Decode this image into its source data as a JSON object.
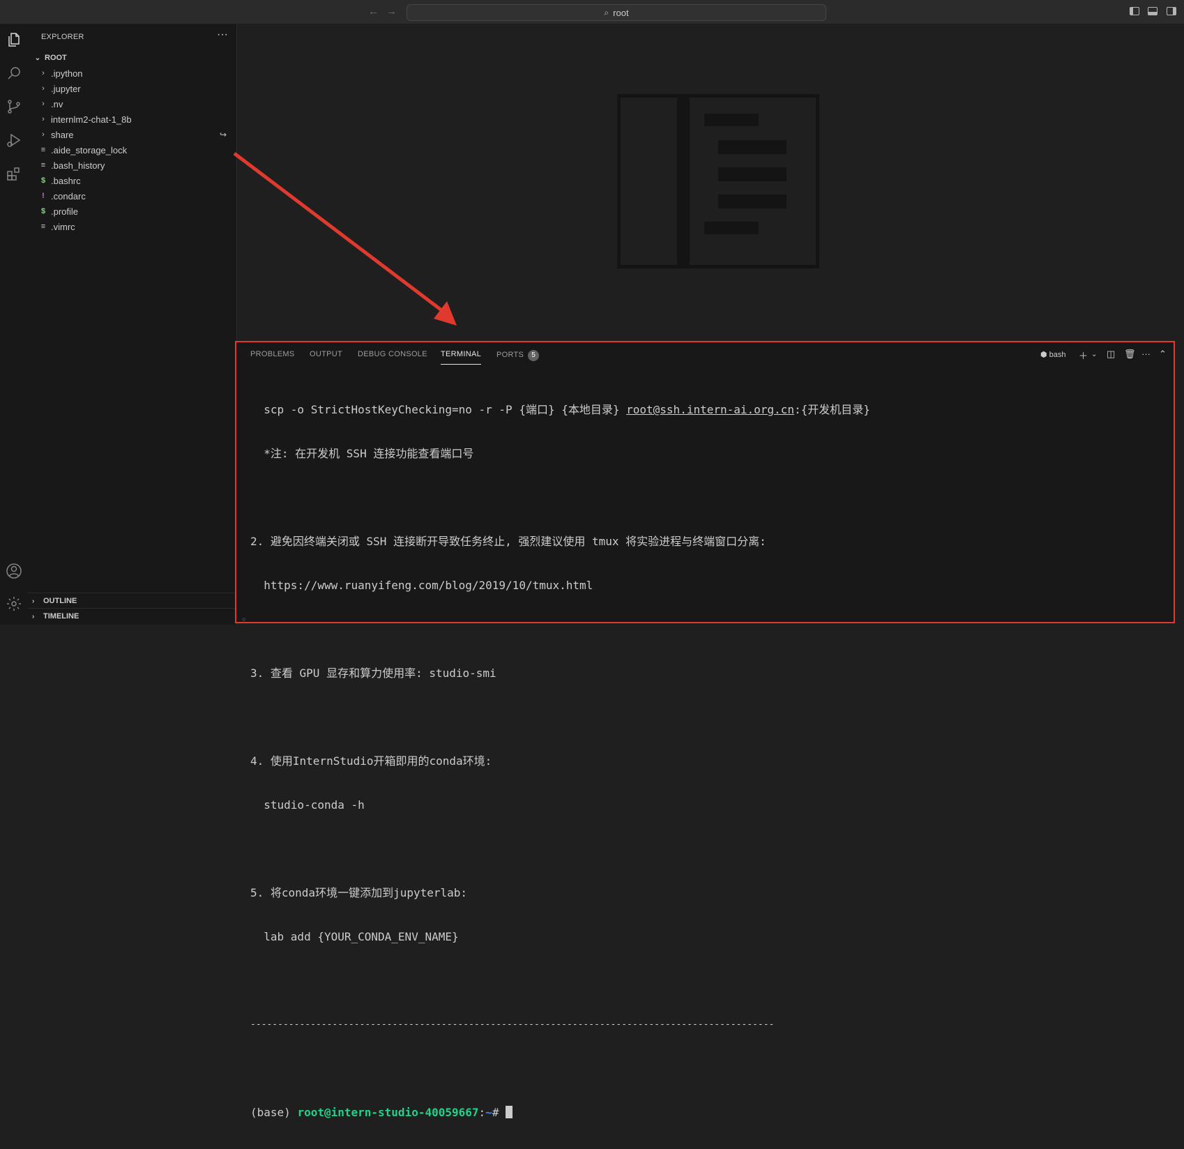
{
  "titlebar": {
    "back_icon": "arrow-left-icon",
    "forward_icon": "arrow-right-icon",
    "search_text": "root"
  },
  "activity_bar": {
    "icons": [
      "explorer-icon",
      "search-icon",
      "source-control-icon",
      "run-debug-icon",
      "extensions-icon",
      "account-icon",
      "settings-gear-icon"
    ]
  },
  "sidebar": {
    "header": "EXPLORER",
    "more": "···",
    "root_label": "ROOT",
    "items": [
      {
        "label": ".ipython",
        "type": "folder"
      },
      {
        "label": ".jupyter",
        "type": "folder"
      },
      {
        "label": ".nv",
        "type": "folder"
      },
      {
        "label": "internlm2-chat-1_8b",
        "type": "folder"
      },
      {
        "label": "share",
        "type": "folder-link"
      },
      {
        "label": ".aide_storage_lock",
        "type": "file-lines"
      },
      {
        "label": ".bash_history",
        "type": "file-lines"
      },
      {
        "label": ".bashrc",
        "type": "file-dollar"
      },
      {
        "label": ".condarc",
        "type": "file-bang"
      },
      {
        "label": ".profile",
        "type": "file-dollar"
      },
      {
        "label": ".vimrc",
        "type": "file-lines"
      }
    ],
    "outline_label": "OUTLINE",
    "timeline_label": "TIMELINE"
  },
  "panel": {
    "tabs": [
      {
        "label": "PROBLEMS"
      },
      {
        "label": "OUTPUT"
      },
      {
        "label": "DEBUG CONSOLE"
      },
      {
        "label": "TERMINAL",
        "active": true
      },
      {
        "label": "PORTS",
        "badge": "5"
      }
    ],
    "shell_label": "bash",
    "terminal": {
      "line1_pre": "  scp -o StrictHostKeyChecking=no -r -P {端口} {本地目录} ",
      "line1_link": "root@ssh.intern-ai.org.cn",
      "line1_post": ":{开发机目录}",
      "line2": "  *注: 在开发机 SSH 连接功能查看端口号",
      "line3": "2. 避免因终端关闭或 SSH 连接断开导致任务终止, 强烈建议使用 tmux 将实验进程与终端窗口分离:",
      "line4": "  https://www.ruanyifeng.com/blog/2019/10/tmux.html",
      "line5": "3. 查看 GPU 显存和算力使用率: studio-smi",
      "line6": "4. 使用InternStudio开箱即用的conda环境:",
      "line7": "  studio-conda -h",
      "line8": "5. 将conda环境一键添加到jupyterlab:",
      "line9": "  lab add {YOUR_CONDA_ENV_NAME}",
      "separator": "------------------------------------------------------------------------------------------------",
      "prompt_env": "(base) ",
      "prompt_user": "root@intern-studio-40059667",
      "prompt_colon": ":",
      "prompt_path": "~",
      "prompt_symbol": "# "
    }
  },
  "colors": {
    "highlight_border": "#e03a2f",
    "prompt_green": "#23d18b",
    "prompt_blue": "#3b8eea"
  }
}
